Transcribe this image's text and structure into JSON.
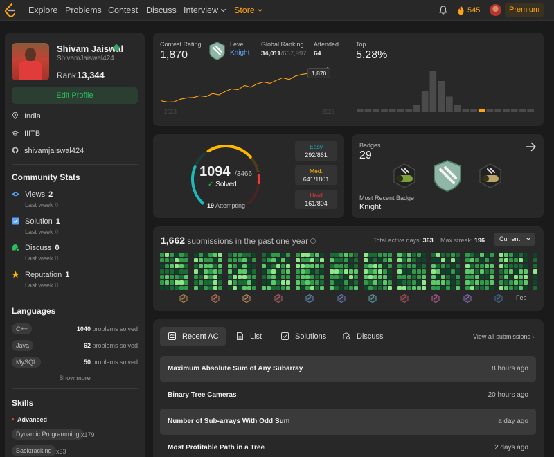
{
  "nav": {
    "items": [
      "Explore",
      "Problems",
      "Contest",
      "Discuss",
      "Interview",
      "Store"
    ],
    "streak": "545",
    "premium": "Premium"
  },
  "profile": {
    "name": "Shivam Jaiswal",
    "handle": "ShivamJaiswal424",
    "rank_label": "Rank",
    "rank": "13,344",
    "edit_label": "Edit Profile",
    "location": "India",
    "school": "IIITB",
    "github": "shivamjaiswal424"
  },
  "community": {
    "title": "Community Stats",
    "stats": [
      {
        "label": "Views",
        "value": "2",
        "sub": "Last week",
        "delta": "0"
      },
      {
        "label": "Solution",
        "value": "1",
        "sub": "Last week",
        "delta": "0"
      },
      {
        "label": "Discuss",
        "value": "0",
        "sub": "Last week",
        "delta": "0"
      },
      {
        "label": "Reputation",
        "value": "1",
        "sub": "Last week",
        "delta": "0"
      }
    ]
  },
  "languages": {
    "title": "Languages",
    "items": [
      {
        "name": "C++",
        "count": "1040",
        "suffix": "problems solved"
      },
      {
        "name": "Java",
        "count": "62",
        "suffix": "problems solved"
      },
      {
        "name": "MySQL",
        "count": "50",
        "suffix": "problems solved"
      }
    ],
    "show_more": "Show more"
  },
  "skills": {
    "title": "Skills",
    "level": "Advanced",
    "items": [
      {
        "name": "Dynamic Programming",
        "count": "x179"
      },
      {
        "name": "Backtracking",
        "count": "x33"
      }
    ]
  },
  "contest": {
    "rating_label": "Contest Rating",
    "rating": "1,870",
    "level_label": "Level",
    "level": "Knight",
    "global_label": "Global Ranking",
    "global_rank": "34,011",
    "global_total": "/667,997",
    "attended_label": "Attended",
    "attended": "64",
    "top_label": "Top",
    "top": "5.28%",
    "tooltip": "1,870",
    "axis_start": "2023",
    "axis_end": "2025",
    "histogram": [
      1,
      1,
      1,
      1,
      1,
      1,
      1,
      4,
      12,
      24,
      18,
      9,
      4,
      2,
      2,
      1,
      1,
      1,
      1,
      1,
      1,
      1
    ],
    "histogram_user_index": 15,
    "rating_history": [
      1500,
      1485,
      1490,
      1520,
      1535,
      1540,
      1560,
      1550,
      1585,
      1570,
      1610,
      1640,
      1630,
      1680,
      1660,
      1700,
      1720,
      1705,
      1740,
      1770,
      1750,
      1790,
      1810,
      1820,
      1850,
      1840,
      1870
    ]
  },
  "solved": {
    "count": "1094",
    "total": "/3466",
    "label": "Solved",
    "attempting_count": "19",
    "attempting_label": "Attempting",
    "easy_label": "Easy",
    "easy": "292/861",
    "medium_label": "Med.",
    "medium": "641/1801",
    "hard_label": "Hard",
    "hard": "161/804",
    "colors": {
      "easy": "#1cbaba",
      "medium": "#ffb700",
      "hard": "#f63737"
    }
  },
  "badges": {
    "label": "Badges",
    "count": "29",
    "recent_label": "Most Recent Badge",
    "recent": "Knight"
  },
  "submissions": {
    "count": "1,662",
    "text": "submissions in the past one year",
    "active_label": "Total active days:",
    "active": "363",
    "streak_label": "Max streak:",
    "streak": "196",
    "filter": "Current",
    "month_last": "Feb"
  },
  "recent": {
    "tabs": [
      "Recent AC",
      "List",
      "Solutions",
      "Discuss"
    ],
    "view_all": "View all submissions",
    "items": [
      {
        "title": "Maximum Absolute Sum of Any Subarray",
        "ago": "8 hours ago"
      },
      {
        "title": "Binary Tree Cameras",
        "ago": "20 hours ago"
      },
      {
        "title": "Number of Sub-arrays With Odd Sum",
        "ago": "a day ago"
      },
      {
        "title": "Most Profitable Path in a Tree",
        "ago": "2 days ago"
      }
    ]
  }
}
